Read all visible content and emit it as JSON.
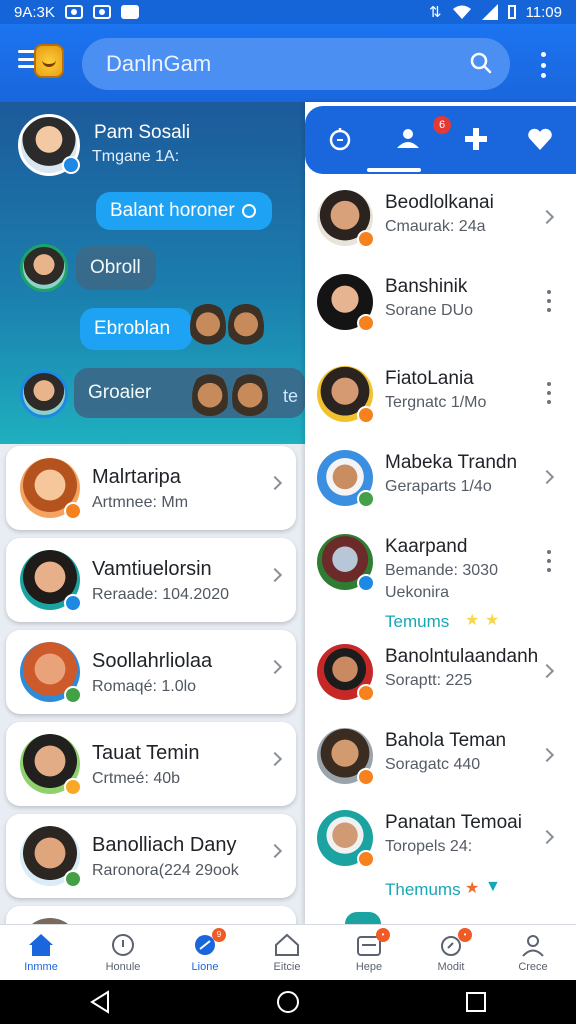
{
  "status": {
    "left_text": "9A:3K",
    "time": "11:09"
  },
  "header": {
    "search_text": "DanlnGam"
  },
  "current_user": {
    "name": "Pam Sosali",
    "subtitle": "Tmgane 1A:"
  },
  "chat": {
    "bubble1": "Balant horoner",
    "bubble2": "Obroll",
    "bubble3": "Ebroblan",
    "bubble4": "Groaier",
    "bubble4_tail": "te"
  },
  "left_list": [
    {
      "name": "Malrtaripa",
      "status": "Artmnee: Mm",
      "avatar": "#f4a460",
      "badge": "#f5821f"
    },
    {
      "name": "Vamtiuelorsin",
      "status": "Reraade: 104.2020",
      "avatar": "#1aa3a0",
      "badge": "#1e88e5"
    },
    {
      "name": "Soollahrliolaa",
      "status": "Romaqé: 1.0lo",
      "avatar": "#2e8bd8",
      "badge": "#43a047"
    },
    {
      "name": "Tauat Temin",
      "status": "Crtmeé: 40b",
      "avatar": "#8fd16c",
      "badge": "#f9a825"
    },
    {
      "name": "Banolliach Dany",
      "status": "Raronora(224 29ook",
      "avatar": "#d9ecf7",
      "badge": "#43a047"
    }
  ],
  "tabs": [
    {
      "icon": "compass-icon"
    },
    {
      "icon": "person-icon",
      "badge": "6"
    },
    {
      "icon": "gamepad-icon"
    },
    {
      "icon": "heart-icon"
    }
  ],
  "right_list": [
    {
      "name": "Beodlolkanai",
      "status": "Cmaurak: 24a",
      "line2": "",
      "action": "chevron",
      "avatar": "#e9e4da",
      "badge": "#f5821f"
    },
    {
      "name": "Banshinik",
      "status": "Sorane DUo",
      "line2": "",
      "action": "dots",
      "avatar": "#1f1f1f",
      "badge": "#f5821f"
    },
    {
      "name": "FiatoLania",
      "status": "Tergnatc 1/Mo",
      "line2": "",
      "action": "dots",
      "avatar": "#f2c12e",
      "badge": "#f5821f"
    },
    {
      "name": "Mabeka Trandn",
      "status": "Geraparts 1/4o",
      "line2": "",
      "action": "chevron",
      "avatar": "#3a8fe0",
      "badge": "#43a047"
    },
    {
      "name": "Kaarpand",
      "status": "Bemande: 3030",
      "line2": "Uekonira",
      "action": "dots",
      "avatar": "#2e7d32",
      "badge": "#1e88e5"
    },
    {
      "name": "Banolntulaandanh",
      "status": "Soraptt: 225",
      "line2": "",
      "action": "chevron",
      "avatar": "#c62828",
      "badge": "#f5821f"
    },
    {
      "name": "Bahola Teman",
      "status": "Soragatc 440",
      "line2": "",
      "action": "chevron",
      "avatar": "#9aa4ad",
      "badge": "#f5821f"
    },
    {
      "name": "Panatan Temoai",
      "status": "Toropels 24:",
      "line2": "",
      "action": "chevron",
      "avatar": "#1aa3a0",
      "badge": "#f5821f"
    }
  ],
  "tags": {
    "tag1": "Temums",
    "tag2": "Themums"
  },
  "bottom_nav": [
    {
      "label": "Inmme",
      "icon": "home-icon",
      "active": true
    },
    {
      "label": "Honule",
      "icon": "info-icon"
    },
    {
      "label": "Lione",
      "icon": "explore-icon",
      "badge": "9"
    },
    {
      "label": "Eitcie",
      "icon": "house-icon"
    },
    {
      "label": "Hepe",
      "icon": "inbox-icon",
      "badge": "•"
    },
    {
      "label": "Modit",
      "icon": "game-icon",
      "badge": "•"
    },
    {
      "label": "Crece",
      "icon": "profile-icon"
    }
  ],
  "colors": {
    "primary": "#1a66dd",
    "accent": "#18a7b5",
    "badge_red": "#e53935"
  }
}
